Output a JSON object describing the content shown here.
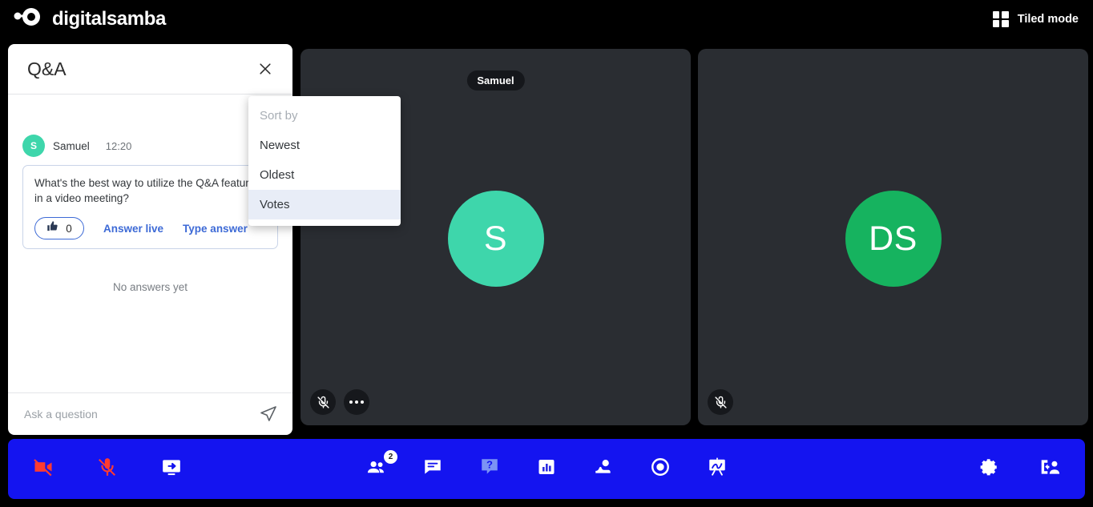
{
  "header": {
    "brand_name": "digitalsamba",
    "brand_logo_icon": "samba-logo-icon",
    "tiled_mode_label": "Tiled mode",
    "tiled_mode_icon": "grid-icon"
  },
  "qa_panel": {
    "title": "Q&A",
    "close_icon": "close-icon",
    "sort_icon": "sort-descending-icon",
    "thread": {
      "author_initial": "S",
      "author": "Samuel",
      "time": "12:20",
      "question": "What's the best way to utilize the Q&A feature in a video meeting?",
      "vote_icon": "thumbs-up-icon",
      "vote_count": "0",
      "answer_live_label": "Answer live",
      "type_answer_label": "Type answer",
      "empty_answers": "No answers yet"
    },
    "input": {
      "value": "",
      "placeholder": "Ask a question",
      "send_icon": "send-icon"
    },
    "avatar_color": "#3ed6ab"
  },
  "sort_menu": {
    "label": "Sort by",
    "items": [
      {
        "label": "Newest",
        "selected": false
      },
      {
        "label": "Oldest",
        "selected": false
      },
      {
        "label": "Votes",
        "selected": true
      }
    ],
    "selected_bg": "#e8edf7"
  },
  "stage": {
    "tiles": [
      {
        "name": "Samuel",
        "initials": "S",
        "avatar_color": "#3ed6ab",
        "mic_icon": "mic-off-icon",
        "more_icon": "more-options-icon",
        "muted": true
      },
      {
        "name": "",
        "initials": "DS",
        "avatar_color": "#16b35f",
        "mic_icon": "mic-off-icon",
        "more_icon": "",
        "muted": true
      }
    ],
    "tile_bg": "#2a2d32"
  },
  "toolbar": {
    "background": "#1414f0",
    "left": [
      {
        "name": "camera-off-button",
        "icon": "camera-off-icon",
        "color": "#ff3b30"
      },
      {
        "name": "mic-off-button",
        "icon": "mic-off-icon",
        "color": "#ff3b30"
      },
      {
        "name": "screen-share-button",
        "icon": "screen-share-icon",
        "color": "#ffffff"
      }
    ],
    "center": [
      {
        "name": "participants-button",
        "icon": "participants-icon",
        "badge": "2"
      },
      {
        "name": "chat-button",
        "icon": "chat-icon",
        "badge": ""
      },
      {
        "name": "qa-button",
        "icon": "question-bubble-icon",
        "badge": "",
        "active": true
      },
      {
        "name": "polls-button",
        "icon": "poll-chart-icon",
        "badge": ""
      },
      {
        "name": "raise-hand-button",
        "icon": "raise-hand-icon",
        "badge": ""
      },
      {
        "name": "record-button",
        "icon": "record-icon",
        "badge": ""
      },
      {
        "name": "whiteboard-button",
        "icon": "whiteboard-icon",
        "badge": ""
      }
    ],
    "right": [
      {
        "name": "settings-button",
        "icon": "gear-icon"
      },
      {
        "name": "leave-meeting-button",
        "icon": "leave-meeting-icon"
      }
    ]
  }
}
